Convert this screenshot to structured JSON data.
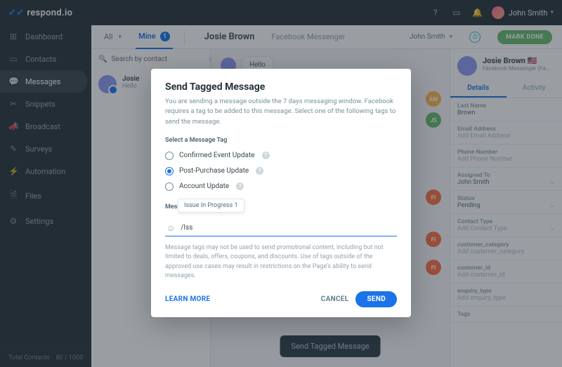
{
  "topbar": {
    "brand": "respond.io",
    "user": "John Smith"
  },
  "sidebar": {
    "items": [
      {
        "icon": "⊞",
        "label": "Dashboard"
      },
      {
        "icon": "▭",
        "label": "Contacts"
      },
      {
        "icon": "💬",
        "label": "Messages",
        "active": true
      },
      {
        "icon": "✂",
        "label": "Snippets"
      },
      {
        "icon": "📣",
        "label": "Broadcast"
      },
      {
        "icon": "✎",
        "label": "Surveys"
      },
      {
        "icon": "⚡",
        "label": "Automation"
      },
      {
        "icon": "🗎",
        "label": "Files"
      },
      {
        "icon": "⚙",
        "label": "Settings"
      }
    ],
    "footer_label": "Total Contacts",
    "footer_value": "80 / 1000"
  },
  "subheader": {
    "tab_all": "All",
    "tab_mine": "Mine",
    "mine_count": "1",
    "contact_name": "Josie Brown",
    "channel": "Facebook Messenger",
    "assignee": "John Smith",
    "mark_done": "MARK DONE"
  },
  "list": {
    "search_placeholder": "Search by contact",
    "contact_name": "Josie",
    "contact_preview": "Hello"
  },
  "chat": {
    "incoming": "Hello",
    "side_badges": [
      "AM",
      "JS",
      "FI",
      "FI",
      "FI"
    ],
    "send_tagged": "Send Tagged Message"
  },
  "details": {
    "name": "Josie Brown",
    "subtitle": "Facebook Messenger (Fa...",
    "tab_details": "Details",
    "tab_activity": "Activity",
    "fields": [
      {
        "label": "Last Name",
        "value": "Brown"
      },
      {
        "label": "Email Address",
        "value": "Add Email Address",
        "ph": true
      },
      {
        "label": "Phone Number",
        "value": "Add Phone Number",
        "ph": true
      },
      {
        "label": "Assigned To",
        "value": "John Smith",
        "chev": true
      },
      {
        "label": "Status",
        "value": "Pending",
        "chev": true
      },
      {
        "label": "Contact Type",
        "value": "Add Contact Type",
        "ph": true,
        "chev": true
      },
      {
        "label": "customer_category",
        "value": "Add customer_category",
        "ph": true
      },
      {
        "label": "customer_id",
        "value": "Add customer_id",
        "ph": true
      },
      {
        "label": "enquiry_type",
        "value": "Add enquiry_type",
        "ph": true
      },
      {
        "label": "Tags",
        "value": ""
      }
    ]
  },
  "modal": {
    "title": "Send Tagged Message",
    "desc": "You are sending a message outside the 7 days messaging window. Facebook requires a tag to be added to this message. Select one of the following tags to send the message.",
    "select_label": "Select a Message Tag",
    "options": [
      {
        "label": "Confirmed Event Update",
        "selected": false
      },
      {
        "label": "Post-Purchase Update",
        "selected": true
      },
      {
        "label": "Account Update",
        "selected": false
      }
    ],
    "message_label": "Mess",
    "suggestion": "Issue In Progress 1",
    "input_value": "/Iss",
    "disclaimer": "Message tags may not be used to send promotional content, including but not limited to deals, offers, coupons, and discounts. Use of tags outside of the approved use cases may result in restrictions on the Page's ability to send messages.",
    "learn_more": "LEARN MORE",
    "cancel": "CANCEL",
    "send": "SEND"
  }
}
